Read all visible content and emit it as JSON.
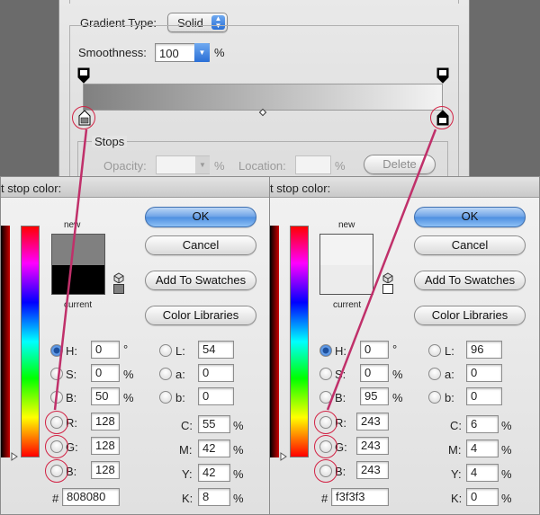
{
  "gradient_editor": {
    "gradient_type_label": "Gradient Type:",
    "gradient_type_value": "Solid",
    "smoothness_label": "Smoothness:",
    "smoothness_value": "100",
    "smoothness_unit": "%",
    "stops_label": "Stops",
    "opacity_label": "Opacity:",
    "opacity_unit": "%",
    "location_label": "Location:",
    "location_unit": "%",
    "delete_label": "Delete",
    "gradient_start_color": "#808080",
    "gradient_end_color": "#f3f3f3"
  },
  "pickers": [
    {
      "title": "t stop color:",
      "ok_label": "OK",
      "cancel_label": "Cancel",
      "add_swatches_label": "Add To Swatches",
      "color_libraries_label": "Color Libraries",
      "new_label": "new",
      "current_label": "current",
      "new_color": "#808080",
      "current_color": "#000000",
      "hsb": {
        "h_label": "H:",
        "h": "0",
        "h_unit": "°",
        "s_label": "S:",
        "s": "0",
        "s_unit": "%",
        "b_label": "B:",
        "b": "50",
        "b_unit": "%"
      },
      "rgb": {
        "r_label": "R:",
        "r": "128",
        "g_label": "G:",
        "g": "128",
        "b_label": "B:",
        "b": "128"
      },
      "lab": {
        "l_label": "L:",
        "l": "54",
        "a_label": "a:",
        "a": "0",
        "b_label": "b:",
        "b": "0"
      },
      "cmyk": {
        "c_label": "C:",
        "c": "55",
        "m_label": "M:",
        "m": "42",
        "y_label": "Y:",
        "y": "42",
        "k_label": "K:",
        "k": "8",
        "unit": "%"
      },
      "hex_label": "#",
      "hex": "808080"
    },
    {
      "title": "t stop color:",
      "ok_label": "OK",
      "cancel_label": "Cancel",
      "add_swatches_label": "Add To Swatches",
      "color_libraries_label": "Color Libraries",
      "new_label": "new",
      "current_label": "current",
      "new_color": "#f3f3f3",
      "current_color": "#ececec",
      "hsb": {
        "h_label": "H:",
        "h": "0",
        "h_unit": "°",
        "s_label": "S:",
        "s": "0",
        "s_unit": "%",
        "b_label": "B:",
        "b": "95",
        "b_unit": "%"
      },
      "rgb": {
        "r_label": "R:",
        "r": "243",
        "g_label": "G:",
        "g": "243",
        "b_label": "B:",
        "b": "243"
      },
      "lab": {
        "l_label": "L:",
        "l": "96",
        "a_label": "a:",
        "a": "0",
        "b_label": "b:",
        "b": "0"
      },
      "cmyk": {
        "c_label": "C:",
        "c": "6",
        "m_label": "M:",
        "m": "4",
        "y_label": "Y:",
        "y": "4",
        "k_label": "K:",
        "k": "0",
        "unit": "%"
      },
      "hex_label": "#",
      "hex": "f3f3f3"
    }
  ],
  "colors": {
    "annotation": "#c0306a",
    "highlight_ring": "#d22244",
    "ok_button": "#5a9ae6"
  }
}
